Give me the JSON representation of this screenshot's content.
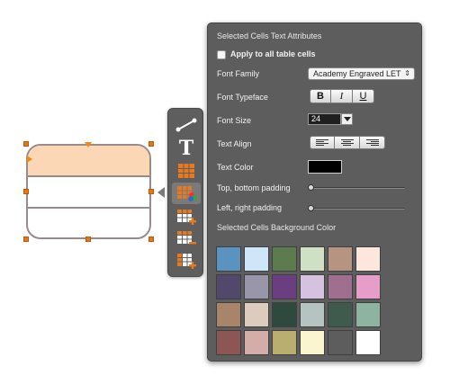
{
  "panel": {
    "title": "Selected Cells Text Attributes",
    "apply_all_label": "Apply to all table cells",
    "apply_all_checked": false,
    "font_family_label": "Font Family",
    "font_family_value": "Academy Engraved LET",
    "font_typeface_label": "Font Typeface",
    "typeface_buttons": [
      "B",
      "I",
      "U"
    ],
    "font_size_label": "Font Size",
    "font_size_value": "24",
    "text_align_label": "Text Align",
    "text_color_label": "Text Color",
    "text_color": "#000000",
    "top_bottom_padding_label": "Top, bottom padding",
    "left_right_padding_label": "Left, right padding",
    "bg_color_title": "Selected Cells Background Color",
    "swatches": [
      "#5b93c0",
      "#cfe6f8",
      "#5c7b4f",
      "#cfe0c5",
      "#b69481",
      "#fde6de",
      "#52486b",
      "#9a96aa",
      "#6a3e80",
      "#d6c2de",
      "#a06f8f",
      "#e69dc7",
      "#a88468",
      "#ddcbbd",
      "#2e4a3f",
      "#b5c4c1",
      "#3f5b4d",
      "#8fb3a1",
      "#8b5653",
      "#d5ada8",
      "#b9ae6e",
      "#fbf5cf",
      "#5d5d5d",
      "#ffffff"
    ]
  },
  "toolbar": {
    "tools": [
      "connector-icon",
      "text-icon",
      "table-style-icon",
      "cell-color-icon",
      "add-row-icon",
      "remove-row-icon",
      "add-column-icon"
    ],
    "selected_index": 3
  },
  "canvas": {
    "header_row_color": "#fcd7b6",
    "handle_color": "#e2781d"
  }
}
